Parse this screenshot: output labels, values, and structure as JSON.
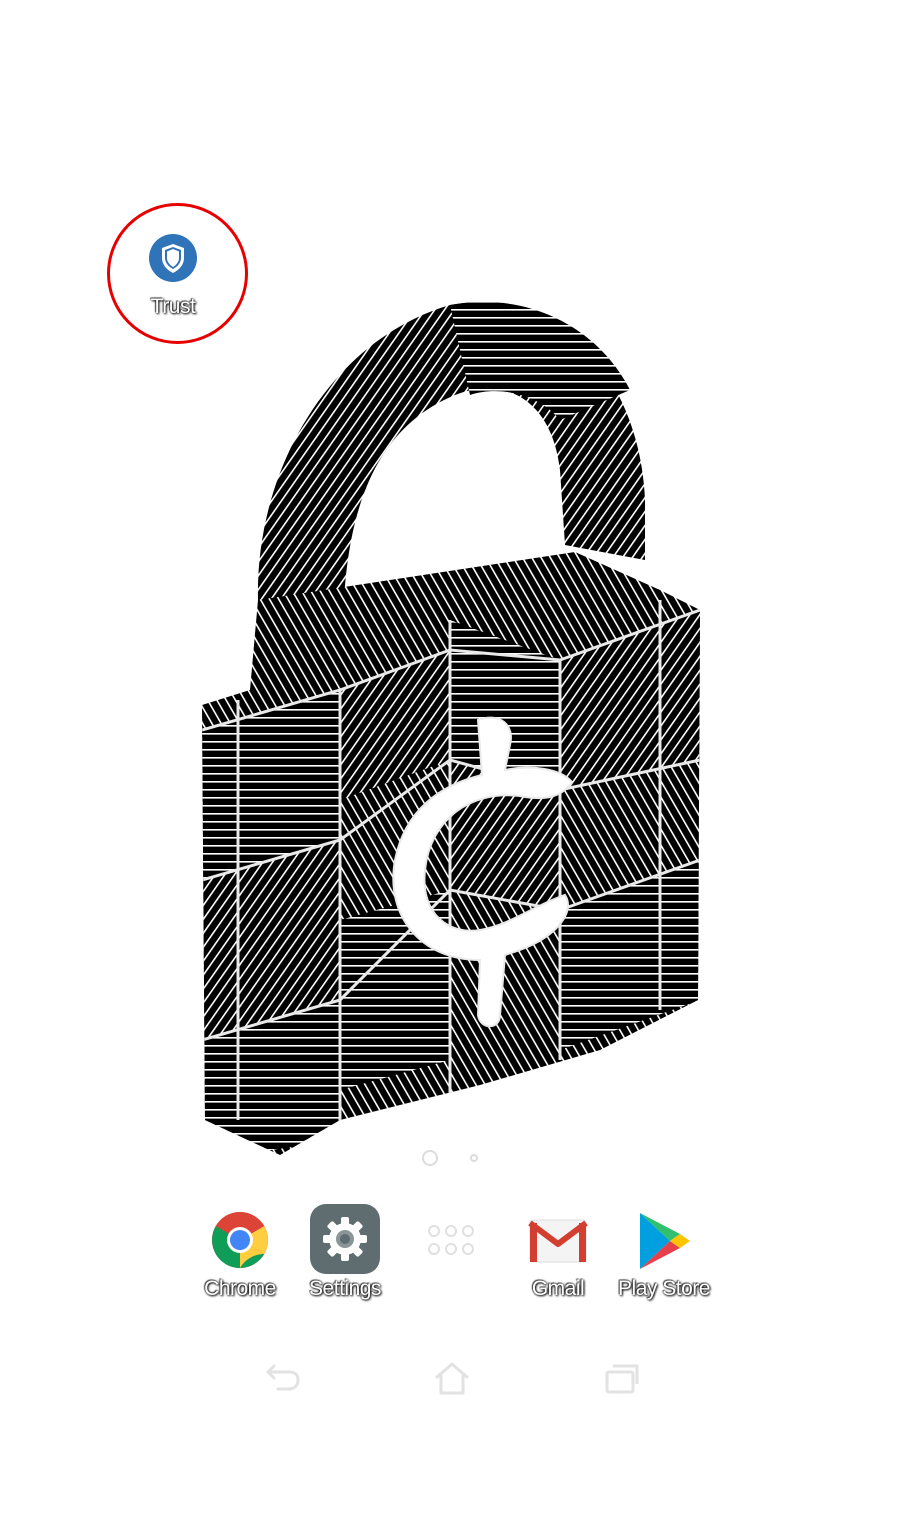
{
  "wallpaper": {
    "name": "padlock-cent-wallpaper"
  },
  "desktop": {
    "shortcut": {
      "label": "Trust",
      "icon": "shield-icon",
      "color": "#2f73b8"
    },
    "highlight_color": "#e60000"
  },
  "pager": {
    "total": 2,
    "current": 1
  },
  "dock": {
    "items": [
      {
        "label": "Chrome",
        "icon": "chrome-icon"
      },
      {
        "label": "Settings",
        "icon": "gear-icon"
      },
      {
        "label": "",
        "icon": "app-drawer-icon"
      },
      {
        "label": "Gmail",
        "icon": "gmail-icon"
      },
      {
        "label": "Play Store",
        "icon": "play-store-icon"
      }
    ]
  },
  "navbar": {
    "buttons": [
      {
        "name": "back",
        "icon": "back-icon"
      },
      {
        "name": "home",
        "icon": "home-icon"
      },
      {
        "name": "recents",
        "icon": "recents-icon"
      }
    ]
  }
}
